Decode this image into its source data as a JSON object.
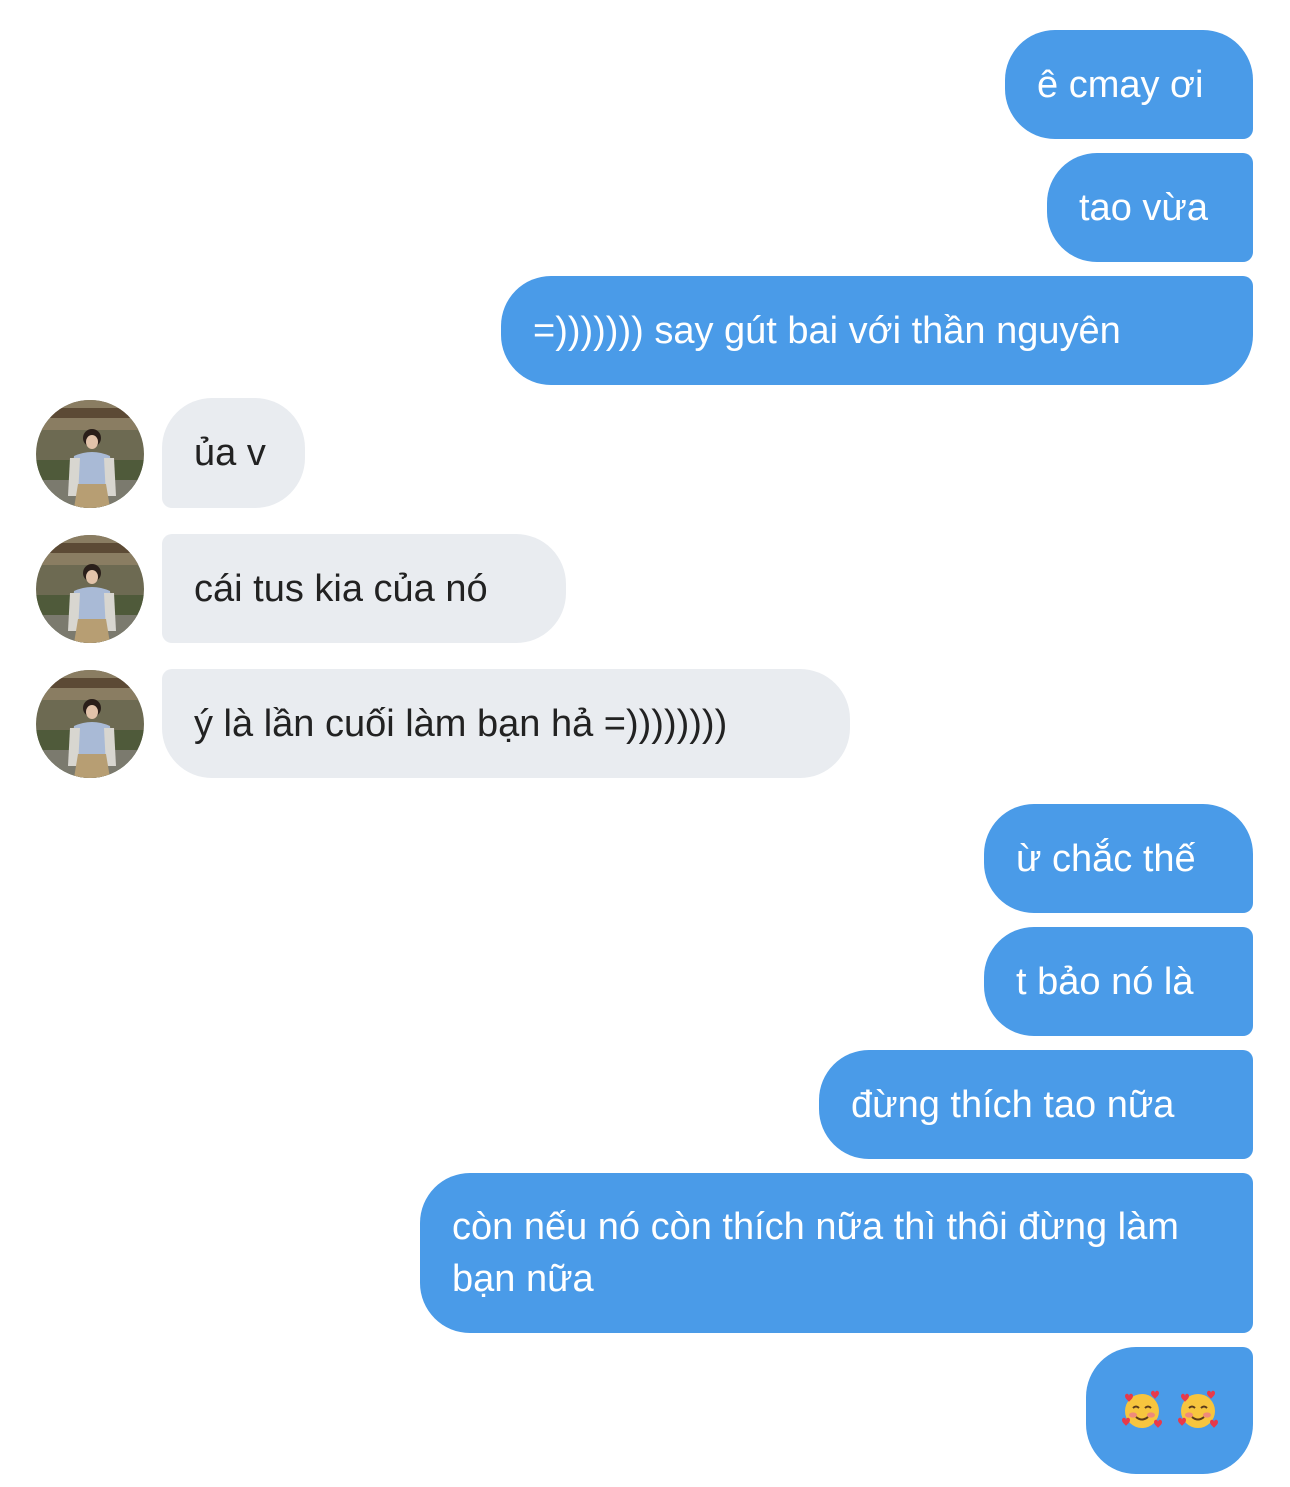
{
  "messages": {
    "m1": "ê cmay ơi",
    "m2": "tao vừa",
    "m3": "=))))))) say gút bai với thần nguyên",
    "m4": "ủa v",
    "m5": "cái tus kia của nó",
    "m6": "ý là lần cuối làm bạn hả =))))))))",
    "m7": "ừ chắc thế",
    "m8": "t bảo nó là",
    "m9": "đừng thích tao nữa",
    "m10": "còn nếu nó còn thích nữa thì thôi đừng làm bạn nữa",
    "m11_emojis": [
      "smiling-face-with-hearts",
      "smiling-face-with-hearts"
    ]
  },
  "colors": {
    "outgoing_bubble": "#4a9be8",
    "incoming_bubble": "#e9ecf0",
    "outgoing_text": "#ffffff",
    "incoming_text": "#222222"
  }
}
